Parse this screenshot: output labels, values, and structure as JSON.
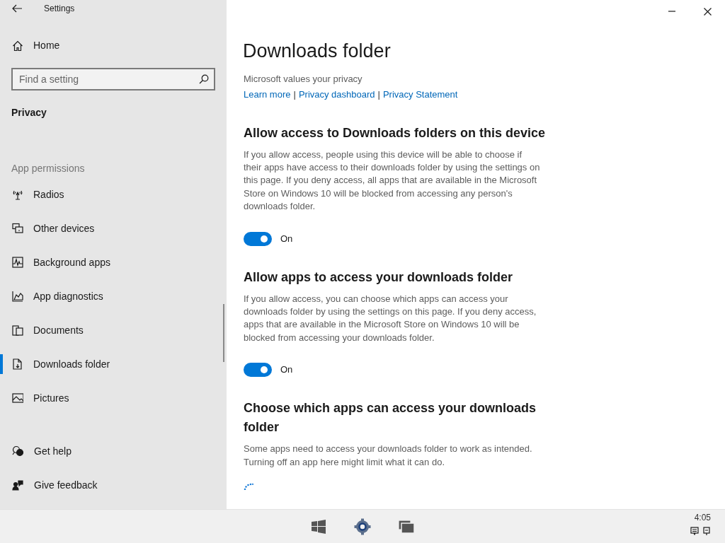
{
  "window": {
    "title": "Settings"
  },
  "sidebar": {
    "home": "Home",
    "search": {
      "placeholder": "Find a setting"
    },
    "section": "Privacy",
    "group_label": "App permissions",
    "items": [
      {
        "label": "Radios",
        "selected": false
      },
      {
        "label": "Other devices",
        "selected": false
      },
      {
        "label": "Background apps",
        "selected": false
      },
      {
        "label": "App diagnostics",
        "selected": false
      },
      {
        "label": "Documents",
        "selected": false
      },
      {
        "label": "Downloads folder",
        "selected": true
      },
      {
        "label": "Pictures",
        "selected": false
      }
    ],
    "footer": [
      "Get help",
      "Give feedback"
    ]
  },
  "main": {
    "title": "Downloads folder",
    "privacy_note": "Microsoft values your privacy",
    "links": [
      "Learn more",
      "Privacy dashboard",
      "Privacy Statement"
    ],
    "separator": "|",
    "sections": [
      {
        "heading": "Allow access to Downloads folders on this device",
        "description": "If you allow access, people using this device will be able to choose if their apps have access to their downloads folder by using the settings on this page. If you deny access, all apps that are available in the Microsoft Store on Windows 10 will be blocked from accessing any person's downloads folder.",
        "toggle": {
          "on": true,
          "label": "On"
        }
      },
      {
        "heading": "Allow apps to access your downloads folder",
        "description": "If you allow access, you can choose which apps can access your downloads folder by using the settings on this page. If you deny access, apps that are available in the Microsoft Store on Windows 10 will be blocked from accessing your downloads folder.",
        "toggle": {
          "on": true,
          "label": "On"
        }
      },
      {
        "heading": "Choose which apps can access your downloads folder",
        "description": "Some apps need to access your downloads folder to work as intended. Turning off an app here might limit what it can do.",
        "loading": true
      }
    ]
  },
  "taskbar": {
    "clock": "4:05"
  }
}
